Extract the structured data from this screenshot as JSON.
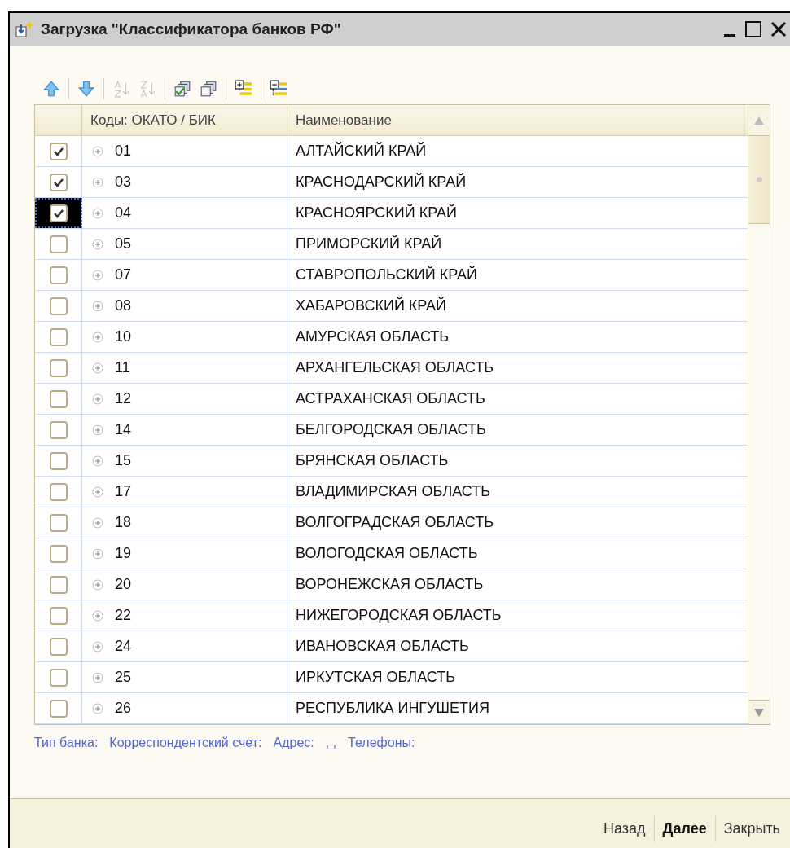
{
  "window": {
    "title": "Загрузка \"Классификатора банков РФ\""
  },
  "toolbar": [
    {
      "kind": "up",
      "disabled": false
    },
    {
      "kind": "down",
      "disabled": false
    },
    {
      "kind": "sort-asc",
      "disabled": true
    },
    {
      "kind": "sort-desc",
      "disabled": true
    },
    {
      "kind": "check-all",
      "disabled": false
    },
    {
      "kind": "uncheck-all",
      "disabled": false
    },
    {
      "kind": "expand",
      "disabled": false
    },
    {
      "kind": "collapse",
      "disabled": false
    }
  ],
  "table": {
    "columns": [
      "Коды: ОКАТО / БИК",
      "Наименование"
    ],
    "rows": [
      {
        "checked": true,
        "selected": false,
        "code": "01",
        "name": "АЛТАЙСКИЙ КРАЙ"
      },
      {
        "checked": true,
        "selected": false,
        "code": "03",
        "name": "КРАСНОДАРСКИЙ КРАЙ"
      },
      {
        "checked": true,
        "selected": true,
        "code": "04",
        "name": "КРАСНОЯРСКИЙ КРАЙ"
      },
      {
        "checked": false,
        "selected": false,
        "code": "05",
        "name": "ПРИМОРСКИЙ КРАЙ"
      },
      {
        "checked": false,
        "selected": false,
        "code": "07",
        "name": "СТАВРОПОЛЬСКИЙ КРАЙ"
      },
      {
        "checked": false,
        "selected": false,
        "code": "08",
        "name": "ХАБАРОВСКИЙ КРАЙ"
      },
      {
        "checked": false,
        "selected": false,
        "code": "10",
        "name": "АМУРСКАЯ ОБЛАСТЬ"
      },
      {
        "checked": false,
        "selected": false,
        "code": "11",
        "name": "АРХАНГЕЛЬСКАЯ ОБЛАСТЬ"
      },
      {
        "checked": false,
        "selected": false,
        "code": "12",
        "name": "АСТРАХАНСКАЯ ОБЛАСТЬ"
      },
      {
        "checked": false,
        "selected": false,
        "code": "14",
        "name": "БЕЛГОРОДСКАЯ ОБЛАСТЬ"
      },
      {
        "checked": false,
        "selected": false,
        "code": "15",
        "name": "БРЯНСКАЯ ОБЛАСТЬ"
      },
      {
        "checked": false,
        "selected": false,
        "code": "17",
        "name": "ВЛАДИМИРСКАЯ ОБЛАСТЬ"
      },
      {
        "checked": false,
        "selected": false,
        "code": "18",
        "name": "ВОЛГОГРАДСКАЯ ОБЛАСТЬ"
      },
      {
        "checked": false,
        "selected": false,
        "code": "19",
        "name": "ВОЛОГОДСКАЯ ОБЛАСТЬ"
      },
      {
        "checked": false,
        "selected": false,
        "code": "20",
        "name": "ВОРОНЕЖСКАЯ ОБЛАСТЬ"
      },
      {
        "checked": false,
        "selected": false,
        "code": "22",
        "name": "НИЖЕГОРОДСКАЯ ОБЛАСТЬ"
      },
      {
        "checked": false,
        "selected": false,
        "code": "24",
        "name": "ИВАНОВСКАЯ ОБЛАСТЬ"
      },
      {
        "checked": false,
        "selected": false,
        "code": "25",
        "name": "ИРКУТСКАЯ ОБЛАСТЬ"
      },
      {
        "checked": false,
        "selected": false,
        "code": "26",
        "name": "РЕСПУБЛИКА ИНГУШЕТИЯ"
      }
    ]
  },
  "info": [
    "Тип банка:",
    "Корреспондентский счет:",
    "Адрес:",
    ", ,",
    "Телефоны:"
  ],
  "buttons": [
    {
      "label": "Назад",
      "default": false
    },
    {
      "label": "Далее",
      "default": true
    },
    {
      "label": "Закрыть",
      "default": false
    }
  ]
}
